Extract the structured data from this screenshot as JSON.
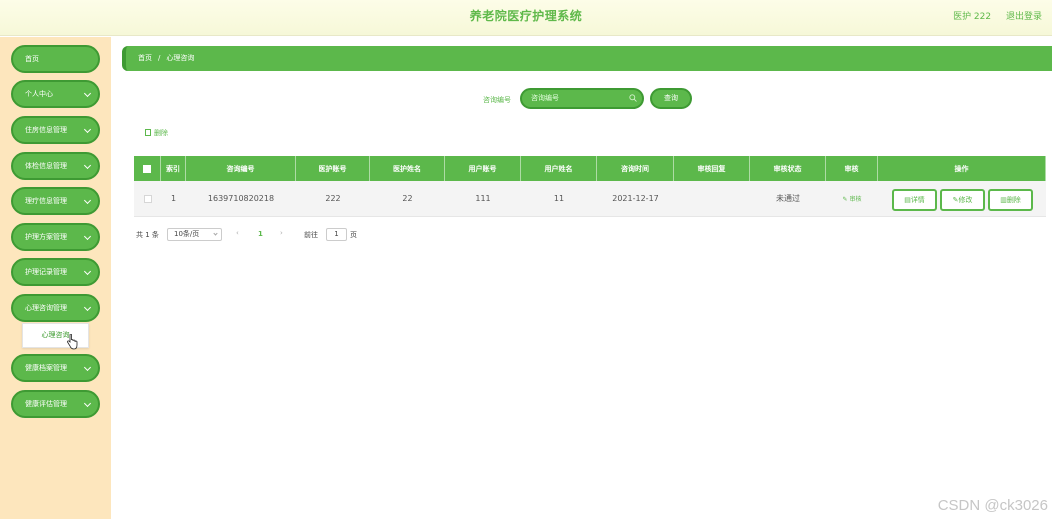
{
  "header": {
    "title": "养老院医疗护理系统",
    "user": "医护 222",
    "logout": "退出登录"
  },
  "sidebar": {
    "items": [
      {
        "label": "首页",
        "has_children": false
      },
      {
        "label": "个人中心",
        "has_children": true
      },
      {
        "label": "住房信息管理",
        "has_children": true
      },
      {
        "label": "体检信息管理",
        "has_children": true
      },
      {
        "label": "理疗信息管理",
        "has_children": true
      },
      {
        "label": "护理方案管理",
        "has_children": true
      },
      {
        "label": "护理记录管理",
        "has_children": true
      },
      {
        "label": "心理咨询管理",
        "has_children": true
      },
      {
        "label": "健康档案管理",
        "has_children": true
      },
      {
        "label": "健康评估管理",
        "has_children": true
      }
    ],
    "submenu_label": "心理咨询"
  },
  "breadcrumb": {
    "home": "首页",
    "separator": "/",
    "current": "心理咨询"
  },
  "search": {
    "label": "咨询编号",
    "placeholder": "咨询编号",
    "button": "查询"
  },
  "actions": {
    "delete": "删除"
  },
  "table": {
    "headers": [
      "索引",
      "咨询编号",
      "医护账号",
      "医护姓名",
      "用户账号",
      "用户姓名",
      "咨询时间",
      "审核回复",
      "审核状态",
      "审核",
      "操作"
    ],
    "rows": [
      {
        "index": "1",
        "consult_no": "1639710820218",
        "staff_account": "222",
        "staff_name": "22",
        "user_account": "111",
        "user_name": "11",
        "consult_time": "2021-12-17",
        "reply": "",
        "status": "未通过",
        "audit": "审核"
      }
    ],
    "op_detail": "详情",
    "op_edit": "修改",
    "op_delete": "删除"
  },
  "pagination": {
    "total": "共 1 条",
    "page_size": "10条/页",
    "current_page": "1",
    "goto": "前往",
    "goto_value": "1",
    "unit": "页"
  },
  "watermark": "CSDN @ck3026",
  "colors": {
    "primary": "#5cb84b",
    "primary_dark": "#3e9a33",
    "sidebar_bg": "#fde6bd",
    "header_bg": "#f6f8d8"
  }
}
